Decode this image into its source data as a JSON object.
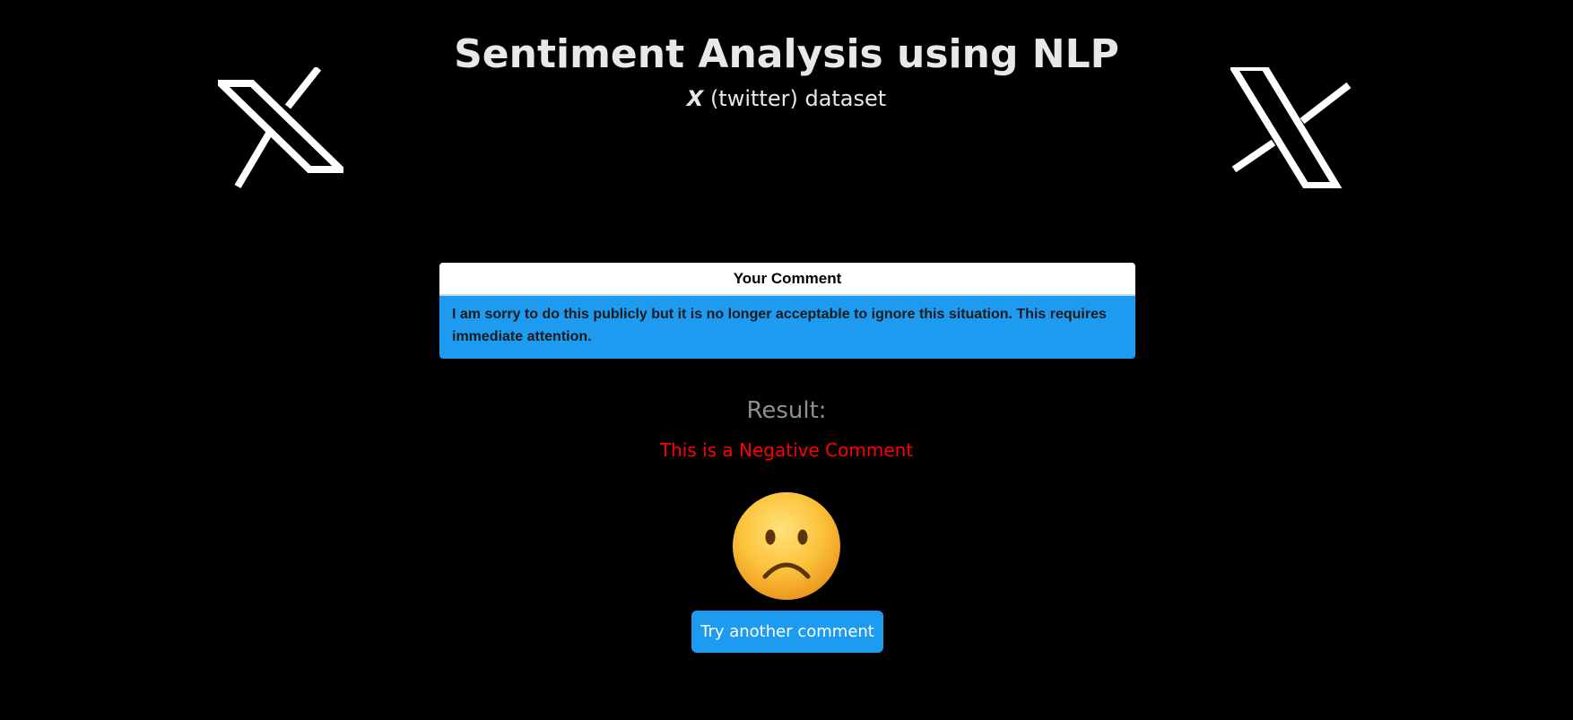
{
  "header": {
    "title": "Sentiment Analysis using NLP",
    "subtitle_mark": "X",
    "subtitle_rest": "(twitter) dataset"
  },
  "icons": {
    "left_logo": "x-logo-icon",
    "right_logo": "x-logo-icon",
    "result_emoji": "sad-face-icon"
  },
  "comment": {
    "heading": "Your Comment",
    "text": "I am sorry to do this publicly but it is no longer acceptable to ignore this situation. This requires immediate attention."
  },
  "result": {
    "label": "Result:",
    "text": "This is a Negative Comment"
  },
  "actions": {
    "try_another_label": "Try another comment"
  },
  "colors": {
    "background": "#000000",
    "accent": "#1d9bf0",
    "negative": "#ff0000",
    "result_label": "#8f8f8f"
  }
}
